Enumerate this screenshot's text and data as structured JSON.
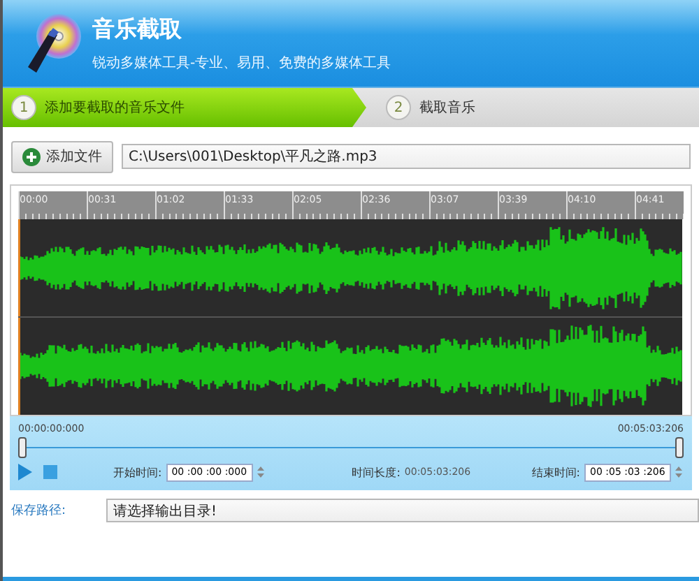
{
  "app": {
    "title": "音乐截取",
    "subtitle": "锐动多媒体工具-专业、易用、免费的多媒体工具"
  },
  "steps": [
    {
      "number": "1",
      "label": "添加要截取的音乐文件",
      "selected": true
    },
    {
      "number": "2",
      "label": "截取音乐",
      "selected": false
    }
  ],
  "add_file_button": "添加文件",
  "file_path": "C:\\Users\\001\\Desktop\\平凡之路.mp3",
  "timeline": {
    "ticks": [
      "00:00",
      "00:31",
      "01:02",
      "01:33",
      "02:05",
      "02:36",
      "03:07",
      "03:39",
      "04:10",
      "04:41"
    ]
  },
  "range": {
    "start_label": "00:00:00:000",
    "end_label": "00:05:03:206",
    "handles": [
      {
        "level": 0
      },
      {
        "level": 1
      }
    ]
  },
  "controls": {
    "start_time_label": "开始时间:",
    "start_time": "00 :00 :00 :000",
    "duration_label": "时间长度:",
    "duration": "00:05:03:206",
    "end_time_label": "结束时间:",
    "end_time": "00 :05 :03 :206"
  },
  "save_path": {
    "label": "保存路径:",
    "value": "请选择输出目录!"
  }
}
